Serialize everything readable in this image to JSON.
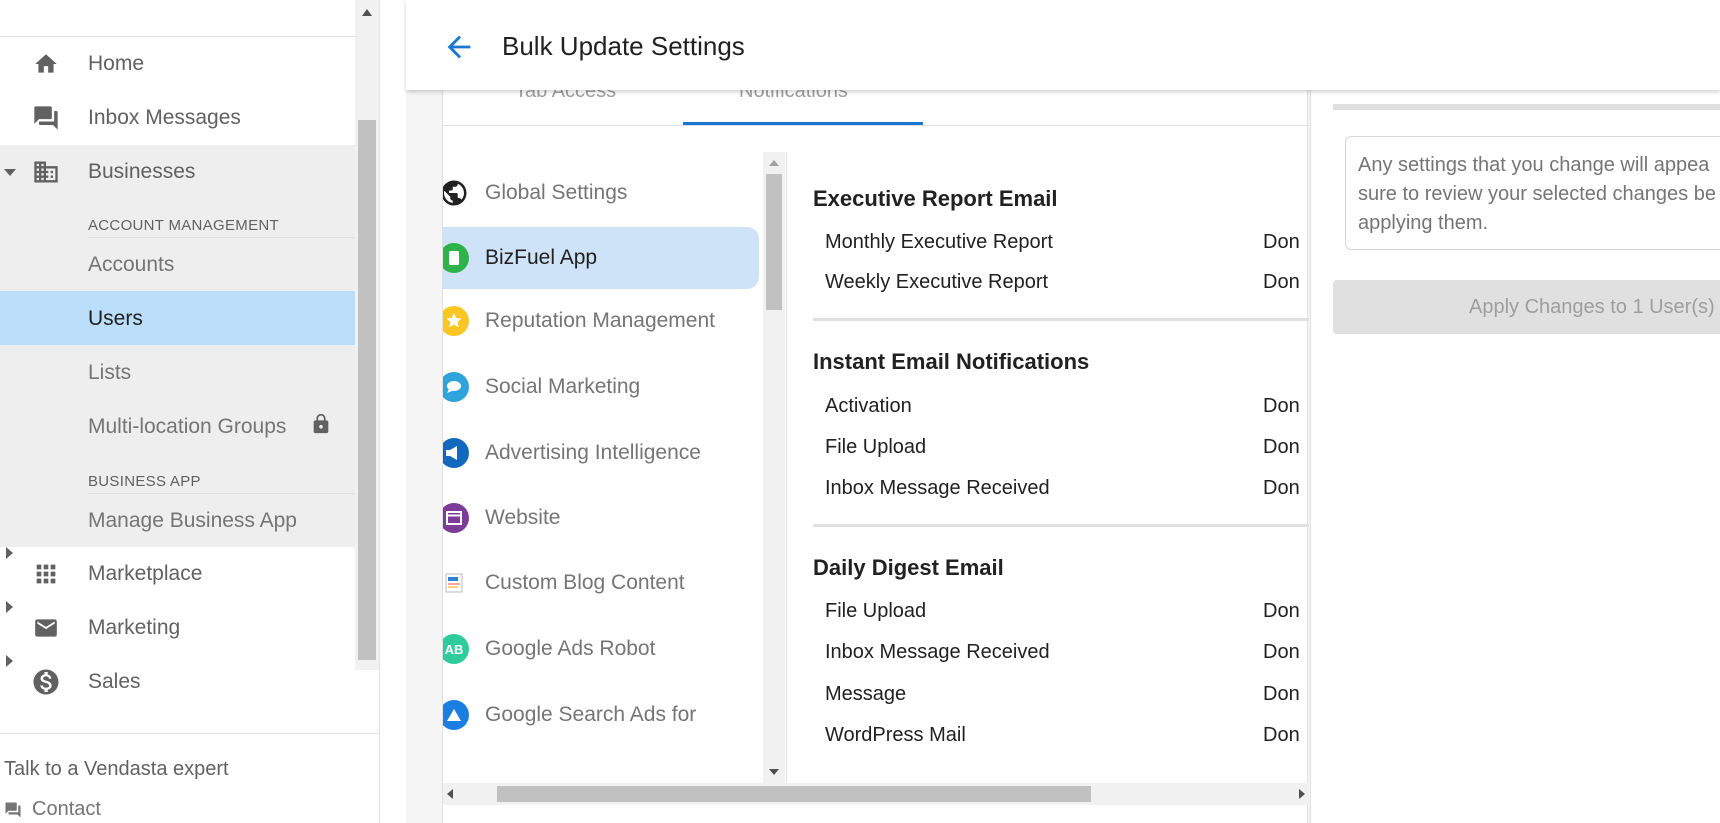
{
  "header": {
    "title": "Bulk Update Settings"
  },
  "sidebar": {
    "items": [
      {
        "label": "Home",
        "icon": "home-icon"
      },
      {
        "label": "Inbox Messages",
        "icon": "chat-icon"
      },
      {
        "label": "Businesses",
        "icon": "building-icon"
      }
    ],
    "account_management": {
      "heading": "ACCOUNT MANAGEMENT",
      "items": [
        "Accounts",
        "Users",
        "Lists",
        "Multi-location Groups"
      ],
      "active": "Users"
    },
    "business_app": {
      "heading": "BUSINESS APP",
      "items": [
        "Manage Business App"
      ]
    },
    "more_items": [
      {
        "label": "Marketplace",
        "icon": "grid-icon"
      },
      {
        "label": "Marketing",
        "icon": "mail-icon"
      },
      {
        "label": "Sales",
        "icon": "dollar-icon"
      }
    ],
    "peek_label": "T",
    "footer": {
      "talk": "Talk to a Vendasta expert",
      "contact": "Contact"
    }
  },
  "tabs": [
    {
      "label": "Tab Access"
    },
    {
      "label": "Notifications",
      "active": true
    }
  ],
  "apps": [
    {
      "label": "Global Settings",
      "icon": "globe-icon",
      "color": "#212121"
    },
    {
      "label": "BizFuel App",
      "icon": "bizfuel-icon",
      "color": "#2db34a",
      "selected": true
    },
    {
      "label": "Reputation Management",
      "icon": "star-icon",
      "color": "#f9c623"
    },
    {
      "label": "Social Marketing",
      "icon": "social-icon",
      "color": "#2fa3dc"
    },
    {
      "label": "Advertising Intelligence",
      "icon": "megaphone-icon",
      "color": "#1168bd"
    },
    {
      "label": "Website",
      "icon": "website-icon",
      "color": "#7d3c98"
    },
    {
      "label": "Custom Blog Content",
      "icon": "blog-icon",
      "color": "#2f80d6"
    },
    {
      "label": "Google Ads Robot",
      "icon": "ab-icon",
      "color": "#2ecc9b"
    },
    {
      "label": "Google Search Ads for",
      "icon": "search-ads-icon",
      "color": "#1a7fe0"
    }
  ],
  "sections": [
    {
      "title": "Executive Report Email",
      "rows": [
        {
          "label": "Monthly Executive Report",
          "value": "Don"
        },
        {
          "label": "Weekly Executive Report",
          "value": "Don"
        }
      ]
    },
    {
      "title": "Instant Email Notifications",
      "rows": [
        {
          "label": "Activation",
          "value": "Don"
        },
        {
          "label": "File Upload",
          "value": "Don"
        },
        {
          "label": "Inbox Message Received",
          "value": "Don"
        }
      ]
    },
    {
      "title": "Daily Digest Email",
      "rows": [
        {
          "label": "File Upload",
          "value": "Don"
        },
        {
          "label": "Inbox Message Received",
          "value": "Don"
        },
        {
          "label": "Message",
          "value": "Don"
        },
        {
          "label": "WordPress Mail",
          "value": "Don"
        }
      ]
    }
  ],
  "right_panel": {
    "info_lines": [
      "Any settings that you change will appea",
      "sure to review your selected changes be",
      "applying them."
    ],
    "apply_label": "Apply Changes to 1 User(s)"
  },
  "colors": {
    "accent": "#1976d2",
    "active_nav_bg": "#bbdefb",
    "selected_app_bg": "#cfe3f8"
  }
}
